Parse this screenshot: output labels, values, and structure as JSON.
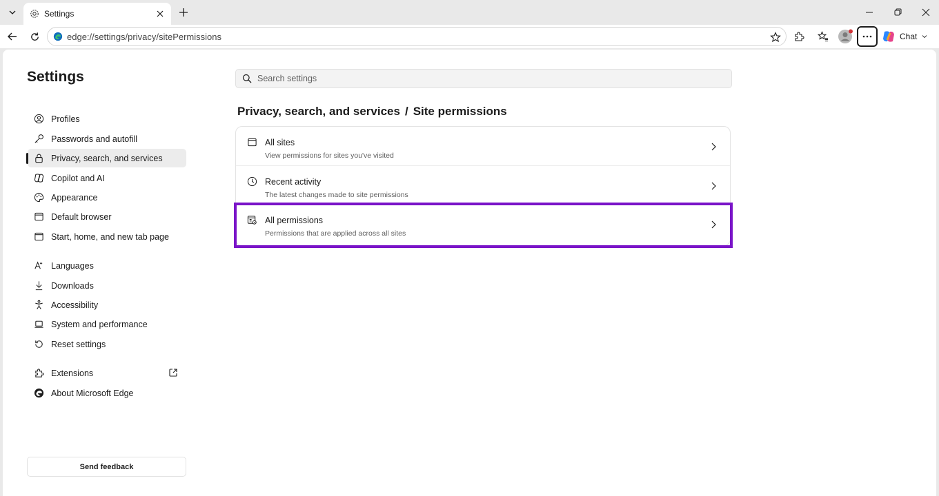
{
  "tab": {
    "title": "Settings",
    "icon": "gear-icon"
  },
  "address": {
    "url": "edge://settings/privacy/sitePermissions"
  },
  "toolbar": {
    "chat_label": "Chat"
  },
  "settings": {
    "title": "Settings",
    "nav_items": [
      {
        "label": "Profiles",
        "icon": "profile-icon"
      },
      {
        "label": "Passwords and autofill",
        "icon": "key-icon"
      },
      {
        "label": "Privacy, search, and services",
        "icon": "lock-icon",
        "active": true
      },
      {
        "label": "Copilot and AI",
        "icon": "copilot-icon"
      },
      {
        "label": "Appearance",
        "icon": "palette-icon"
      },
      {
        "label": "Default browser",
        "icon": "browser-icon"
      },
      {
        "label": "Start, home, and new tab page",
        "icon": "home-icon"
      },
      {
        "label": "Languages",
        "icon": "language-icon"
      },
      {
        "label": "Downloads",
        "icon": "download-icon"
      },
      {
        "label": "Accessibility",
        "icon": "accessibility-icon"
      },
      {
        "label": "System and performance",
        "icon": "laptop-icon"
      },
      {
        "label": "Reset settings",
        "icon": "reset-icon"
      },
      {
        "label": "Extensions",
        "icon": "puzzle-icon"
      },
      {
        "label": "About Microsoft Edge",
        "icon": "edge-icon"
      }
    ],
    "feedback_label": "Send feedback"
  },
  "search": {
    "placeholder": "Search settings"
  },
  "breadcrumb": {
    "parent": "Privacy, search, and services",
    "separator": "/",
    "current": "Site permissions"
  },
  "rows": [
    {
      "title": "All sites",
      "subtitle": "View permissions for sites you've visited",
      "icon": "all-sites-icon"
    },
    {
      "title": "Recent activity",
      "subtitle": "The latest changes made to site permissions",
      "icon": "clock-icon"
    },
    {
      "title": "All permissions",
      "subtitle": "Permissions that are applied across all sites",
      "icon": "permissions-icon"
    }
  ],
  "colors": {
    "highlight": "#7a14c8",
    "accent": "#0f6cbd"
  }
}
